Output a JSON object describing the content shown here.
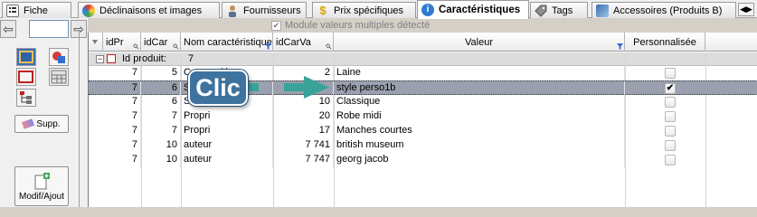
{
  "tabs": [
    {
      "label": "Fiche",
      "icon": "document-list-icon",
      "active": false
    },
    {
      "label": "Déclinaisons et images",
      "icon": "color-wheel-icon",
      "active": false
    },
    {
      "label": "Fournisseurs",
      "icon": "person-icon",
      "active": false
    },
    {
      "label": "Prix spécifiques",
      "icon": "dollar-icon",
      "active": false
    },
    {
      "label": "Caractéristiques",
      "icon": "info-icon",
      "active": true
    },
    {
      "label": "Tags",
      "icon": "tag-icon",
      "active": false
    },
    {
      "label": "Accessoires (Produits B)",
      "icon": "accessories-icon",
      "active": false
    }
  ],
  "options": {
    "multi_value_label": "Module valeurs multiples détecté",
    "multi_value_checked": true
  },
  "toolbar": {
    "page_value": "",
    "supp_label": "Supp.",
    "modif_label": "Modif/Ajout"
  },
  "grid": {
    "headers": [
      "idPr",
      "idCar",
      "Nom caractéristique",
      "idCarVa",
      "Valeur",
      "Personnalisée"
    ],
    "group": {
      "label": "Id produit:",
      "value": "7"
    },
    "rows": [
      {
        "id_product": "7",
        "id_car": "5",
        "name": "Composition",
        "id_car_val": "2",
        "value": "Laine",
        "custom": false,
        "selected": false
      },
      {
        "id_product": "7",
        "id_car": "6",
        "name": "Styles",
        "id_car_val": "",
        "value": "style perso1b",
        "custom": true,
        "selected": true
      },
      {
        "id_product": "7",
        "id_car": "6",
        "name": "Styles",
        "id_car_val": "10",
        "value": "Classique",
        "custom": false,
        "selected": false
      },
      {
        "id_product": "7",
        "id_car": "7",
        "name": "Propri",
        "id_car_val": "20",
        "value": "Robe midi",
        "custom": false,
        "selected": false
      },
      {
        "id_product": "7",
        "id_car": "7",
        "name": "Propri",
        "id_car_val": "17",
        "value": "Manches courtes",
        "custom": false,
        "selected": false
      },
      {
        "id_product": "7",
        "id_car": "10",
        "name": "auteur",
        "id_car_val": "7 741",
        "value": "british museum",
        "custom": false,
        "selected": false
      },
      {
        "id_product": "7",
        "id_car": "10",
        "name": "auteur",
        "id_car_val": "7 747",
        "value": "georg jacob",
        "custom": false,
        "selected": false
      }
    ]
  },
  "annotation": {
    "label": "Clic"
  },
  "colors": {
    "selection": "#9aa0ae",
    "callout": "#3f739f",
    "arrow": "#39a39a"
  }
}
